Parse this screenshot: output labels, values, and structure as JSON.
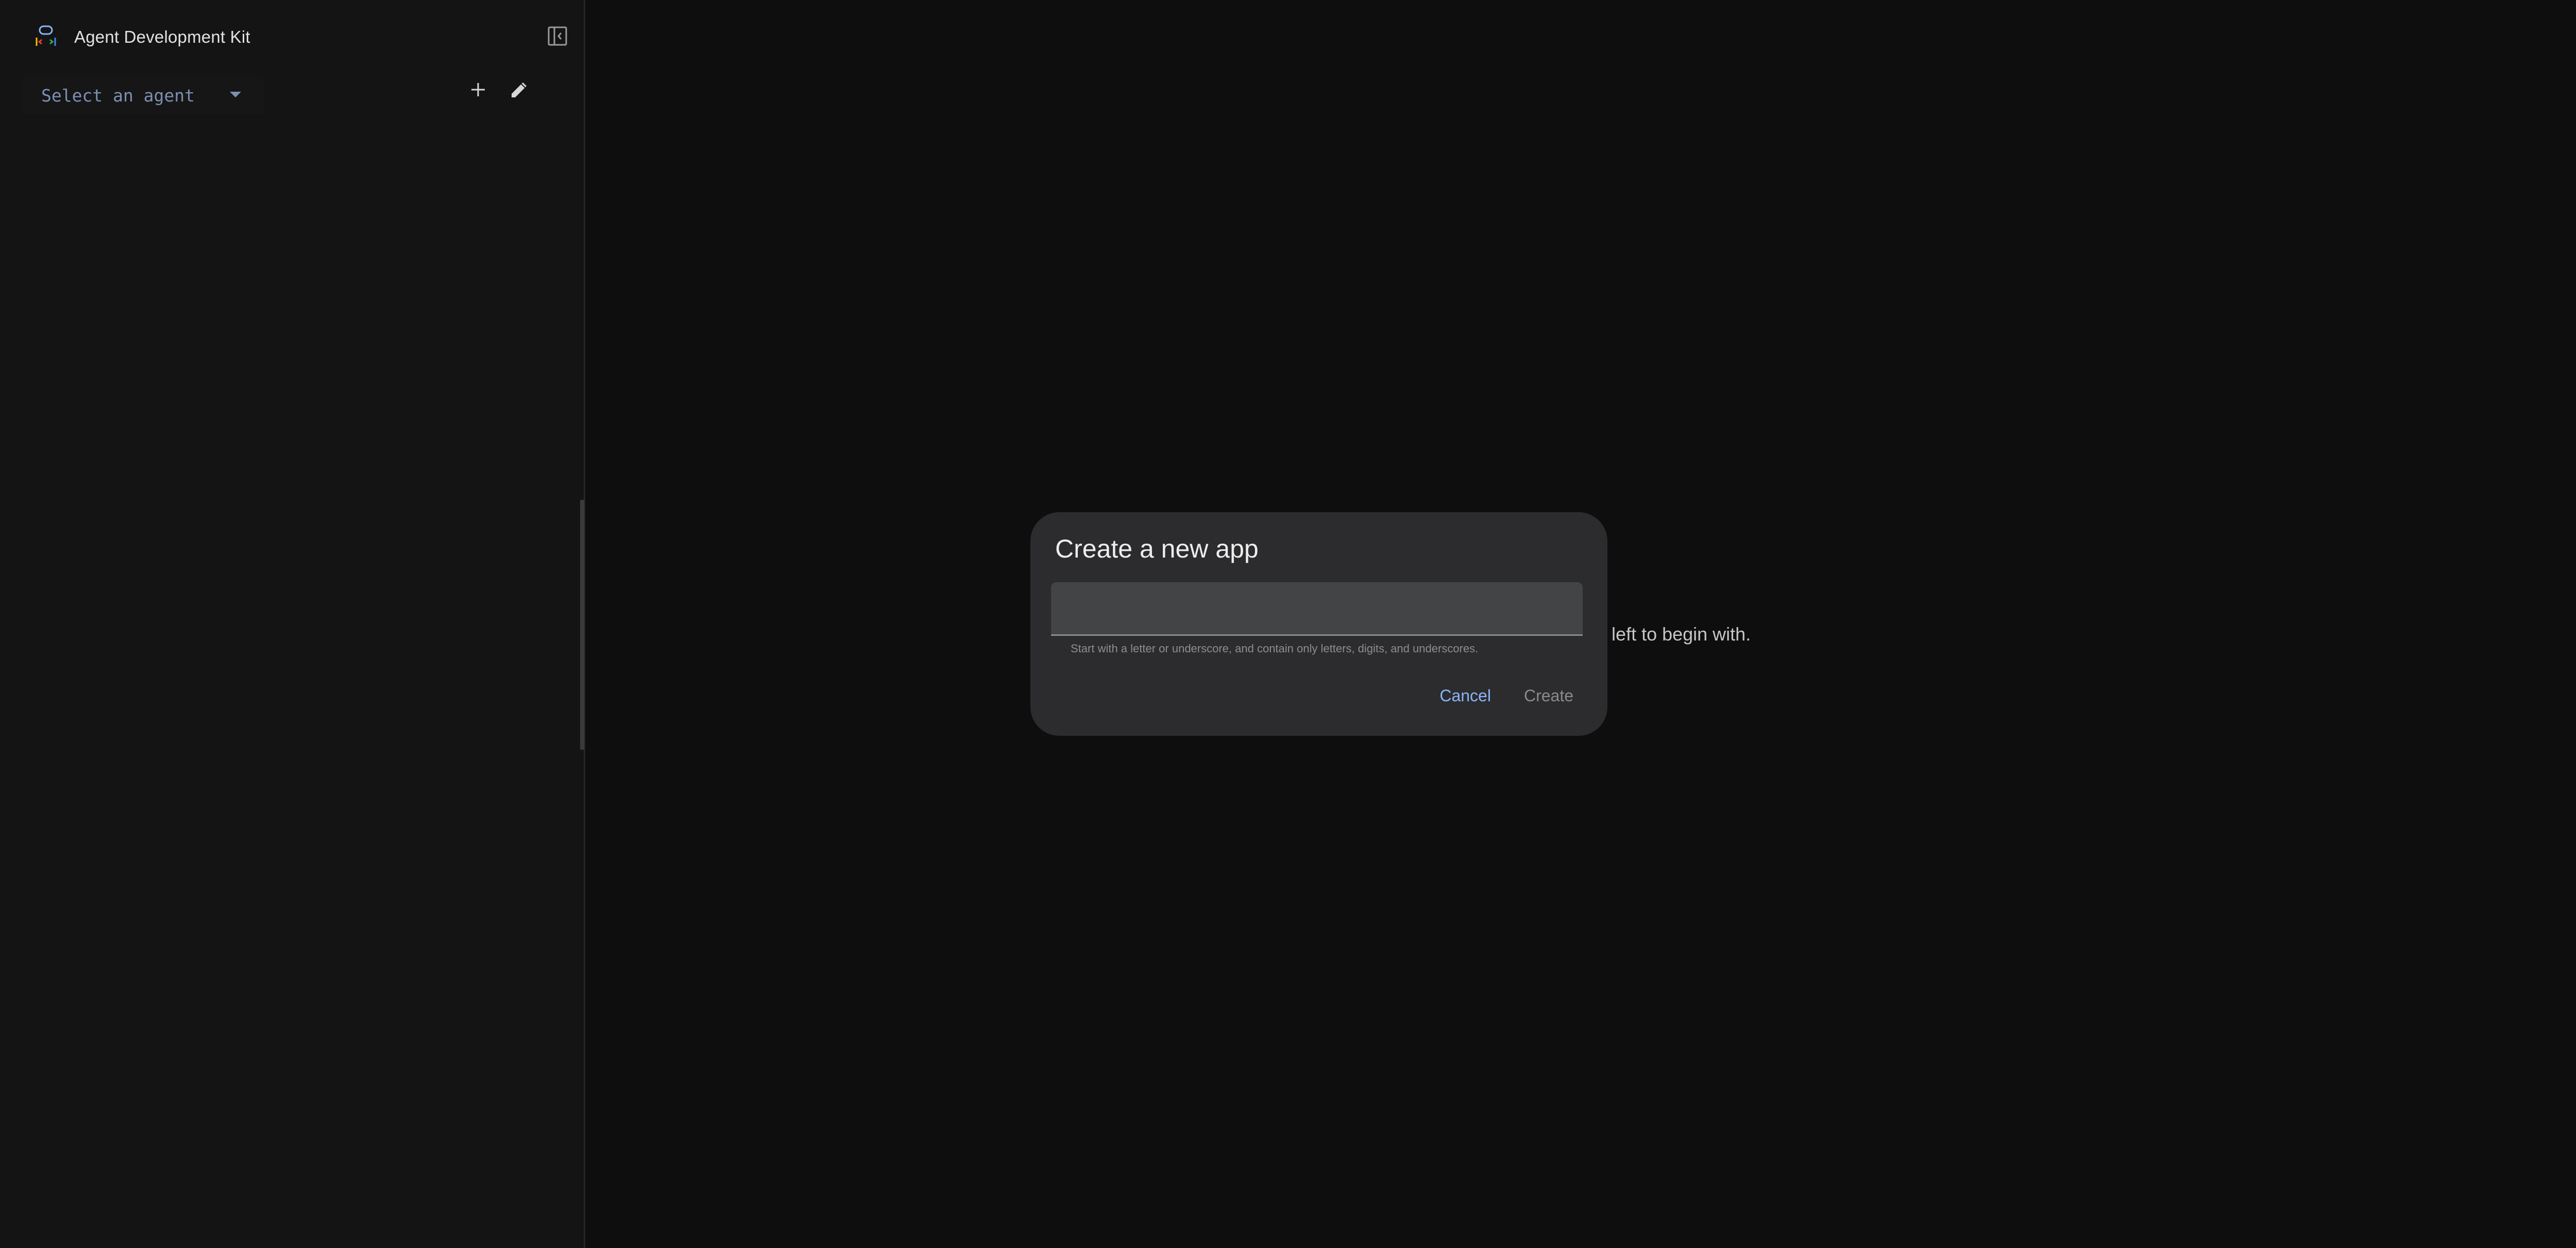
{
  "sidebar": {
    "brand": {
      "title": "Agent Development Kit",
      "logo_icon": "adk-logo-icon"
    },
    "toggle_icon": "sidebar-collapse-icon",
    "agent_select": {
      "value": "Select an agent",
      "icon": "dropdown-caret-icon"
    },
    "add_icon": "plus-icon",
    "edit_icon": "pencil-icon"
  },
  "main": {
    "hint": "the left to begin with."
  },
  "dialog": {
    "title": "Create a new app",
    "input_value": "",
    "input_placeholder": "",
    "input_hint": "Start with a letter or underscore, and contain only letters, digits, and underscores.",
    "cancel_label": "Cancel",
    "create_label": "Create"
  },
  "colors": {
    "background": "#0e0e0e",
    "sidebar": "#141414",
    "dialog": "#2c2c2e",
    "accent": "#8ab4f8",
    "agent_select_text": "#7d8fb3"
  }
}
